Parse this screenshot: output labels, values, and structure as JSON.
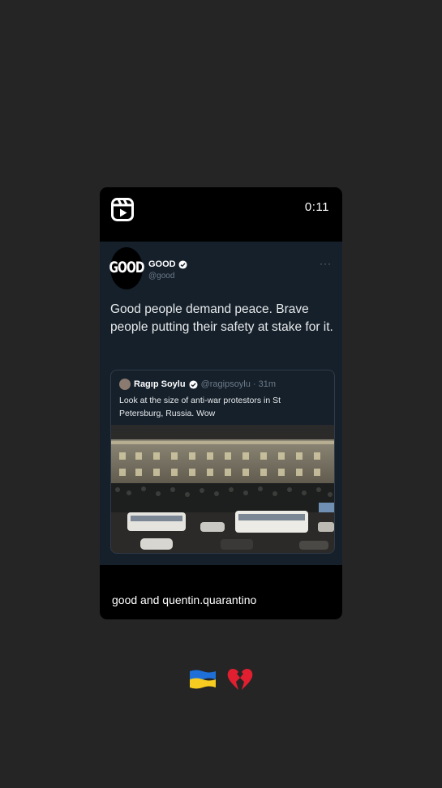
{
  "reel": {
    "timer": "0:11",
    "caption": "good and quentin.quarantino"
  },
  "tweet": {
    "avatar_text": "GOOD",
    "name": "GOOD",
    "handle": "@good",
    "more": "···",
    "text": "Good people demand peace. Brave people putting their safety at stake for it."
  },
  "quote": {
    "name": "Ragıp Soylu",
    "handle": "@ragipsoylu · 31m",
    "text": "Look at the size of anti-war protestors in St Petersburg, Russia. Wow"
  },
  "icons": {
    "reels": "reels-icon",
    "verified": "verified-icon",
    "flag": "ukraine-flag-emoji",
    "heart": "broken-heart-emoji"
  },
  "colors": {
    "page_bg": "#252525",
    "tweet_bg": "#15202b",
    "verified": "#ffffff"
  }
}
